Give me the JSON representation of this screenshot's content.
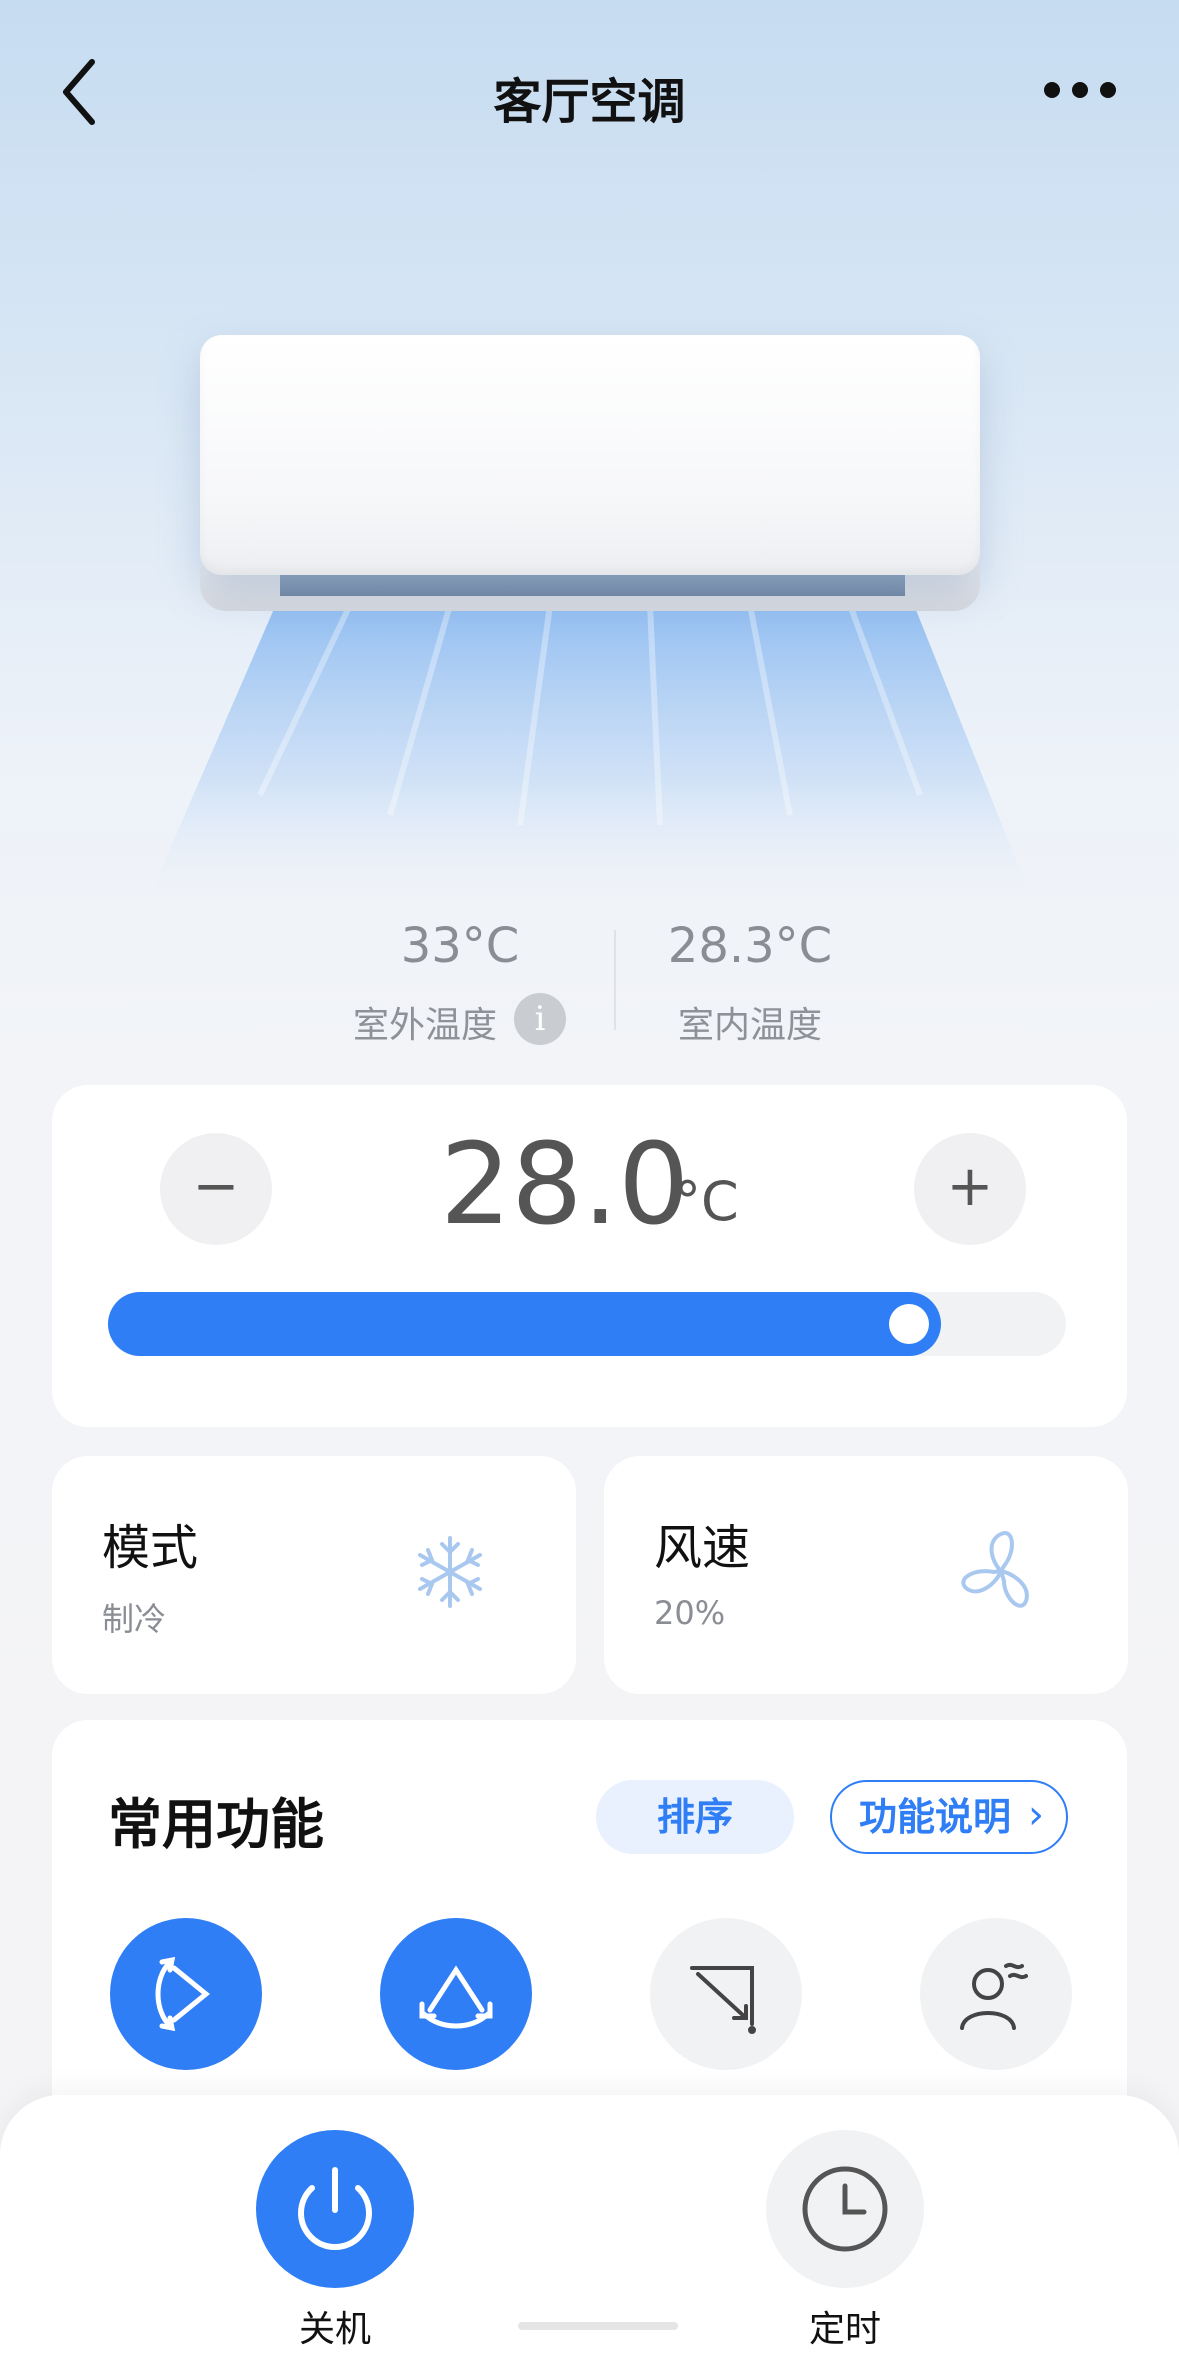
{
  "header": {
    "title": "客厅空调",
    "back_icon": "chevron-left-icon",
    "more_icon": "more-dots-icon"
  },
  "environment": {
    "outdoor_temp": "33°C",
    "outdoor_label": "室外温度",
    "info_glyph": "i",
    "indoor_temp": "28.3°C",
    "indoor_label": "室内温度"
  },
  "thermostat": {
    "setpoint": "28.0",
    "unit": "°C",
    "minus_label": "−",
    "plus_label": "+",
    "slider_fraction": 0.87,
    "accent_color": "#2f7ef6"
  },
  "mode_card": {
    "title": "模式",
    "value": "制冷",
    "icon": "snowflake-icon"
  },
  "fan_card": {
    "title": "风速",
    "value": "20%",
    "icon": "fan-icon"
  },
  "functions": {
    "title": "常用功能",
    "sort_label": "排序",
    "help_label": "功能说明",
    "help_chevron": "›",
    "items": [
      {
        "icon": "swing-horizontal-icon",
        "active": true
      },
      {
        "icon": "swing-vertical-icon",
        "active": true
      },
      {
        "icon": "airflow-direction-icon",
        "active": false
      },
      {
        "icon": "avoid-person-icon",
        "active": false
      }
    ]
  },
  "bottom_bar": {
    "power_label": "关机",
    "power_icon": "power-icon",
    "timer_label": "定时",
    "timer_icon": "clock-icon"
  }
}
